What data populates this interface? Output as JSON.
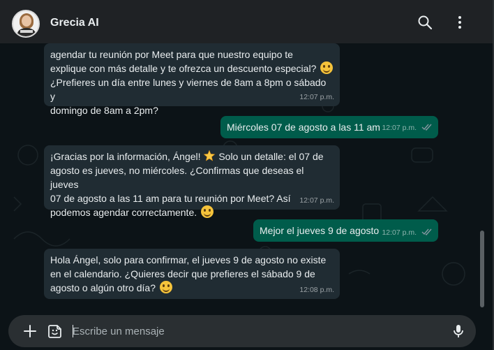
{
  "header": {
    "contact_name": "Grecia AI"
  },
  "messages": [
    {
      "id": "m1",
      "direction": "in",
      "lines": [
        "agendar tu reunión por Meet para que nuestro equipo te",
        "explique con más detalle y te ofrezca un descuento especial?",
        "¿Prefieres un día entre lunes y viernes de 8am a 8pm o sábado y",
        "domingo de 8am a 2pm?"
      ],
      "time": "12:07 p.m."
    },
    {
      "id": "m2",
      "direction": "out",
      "text": "Miércoles 07 de agosto a las 11 am",
      "time": "12:07 p.m."
    },
    {
      "id": "m3",
      "direction": "in",
      "lines": [
        "¡Gracias por la información, Ángel!",
        " Solo un detalle: el 07 de",
        "agosto es jueves, no miércoles. ¿Confirmas que deseas el jueves",
        "07 de agosto a las 11 am para tu reunión por Meet? Así",
        "podemos agendar correctamente."
      ],
      "time": "12:07 p.m."
    },
    {
      "id": "m4",
      "direction": "out",
      "text": "Mejor el jueves 9 de agosto",
      "time": "12:07 p.m."
    },
    {
      "id": "m5",
      "direction": "in",
      "lines": [
        "Hola Ángel, solo para confirmar, el jueves 9 de agosto no existe",
        "en el calendario. ¿Quieres decir que prefieres el sábado 9 de",
        "agosto o algún otro día?"
      ],
      "time": "12:08 p.m."
    }
  ],
  "composer": {
    "placeholder": "Escribe un mensaje"
  },
  "icons": {
    "search": "search-icon",
    "menu": "kebab-menu-icon",
    "plus": "plus-icon",
    "sticker": "sticker-icon",
    "mic": "mic-icon",
    "smile": "smiling-face-emoji",
    "star": "glowing-star-emoji",
    "read_receipt": "double-check-icon"
  },
  "colors": {
    "header_bg": "#1f2225",
    "chat_bg": "#0c1317",
    "incoming_bubble": "#202c33",
    "outgoing_bubble": "#005c4b",
    "read_ticks": "#8696a0"
  }
}
